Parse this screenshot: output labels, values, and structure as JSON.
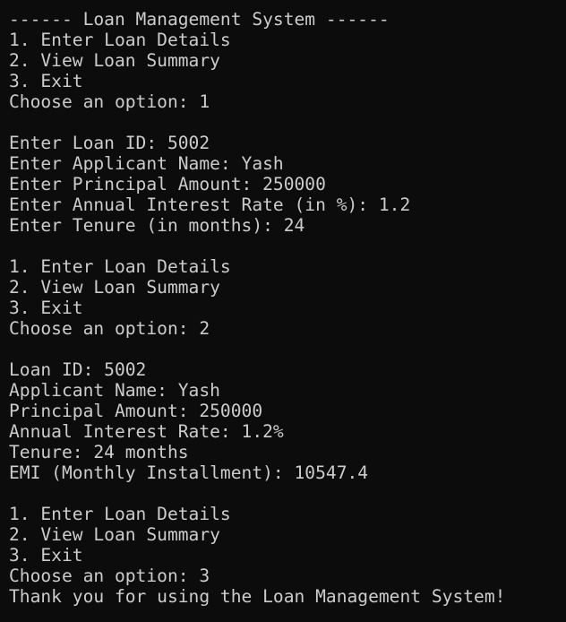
{
  "terminal": {
    "lines": [
      "------ Loan Management System ------",
      "1. Enter Loan Details",
      "2. View Loan Summary",
      "3. Exit",
      "Choose an option: 1",
      "",
      "Enter Loan ID: 5002",
      "Enter Applicant Name: Yash",
      "Enter Principal Amount: 250000",
      "Enter Annual Interest Rate (in %): 1.2",
      "Enter Tenure (in months): 24",
      "",
      "1. Enter Loan Details",
      "2. View Loan Summary",
      "3. Exit",
      "Choose an option: 2",
      "",
      "Loan ID: 5002",
      "Applicant Name: Yash",
      "Principal Amount: 250000",
      "Annual Interest Rate: 1.2%",
      "Tenure: 24 months",
      "EMI (Monthly Installment): 10547.4",
      "",
      "1. Enter Loan Details",
      "2. View Loan Summary",
      "3. Exit",
      "Choose an option: 3",
      "Thank you for using the Loan Management System!"
    ]
  },
  "colors": {
    "background": "#0c0c0c",
    "text": "#cccccc"
  }
}
